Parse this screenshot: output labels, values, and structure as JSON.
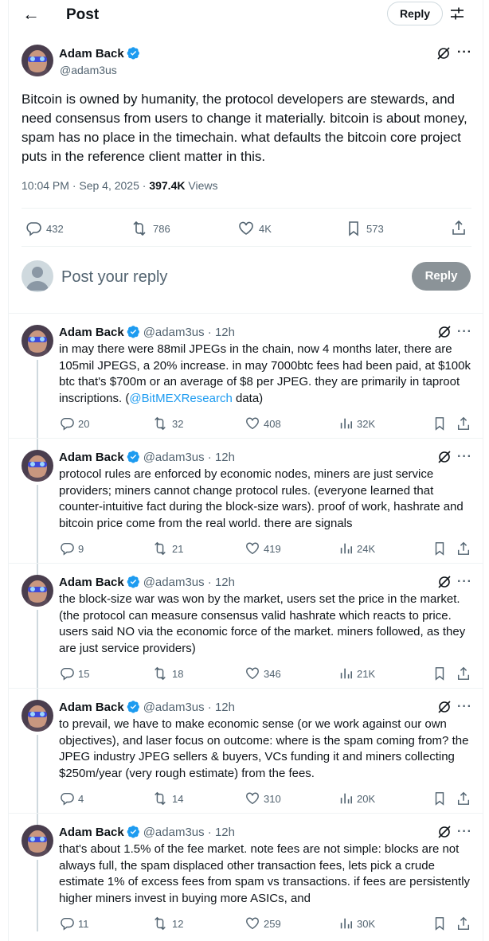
{
  "header": {
    "back_icon": "arrow-left-icon",
    "title": "Post",
    "reply_label": "Reply",
    "filter_icon": "sliders-icon"
  },
  "post": {
    "author": {
      "name": "Adam Back",
      "handle": "@adam3us",
      "verified": true
    },
    "text": "Bitcoin is owned by humanity, the protocol developers are stewards, and need consensus from users to change it materially. bitcoin is about money, spam has no place in the timechain. what defaults the bitcoin core project puts in the reference client matter in this.",
    "time": "10:04 PM · Sep 4, 2025 · ",
    "views_count": "397.4K",
    "views_label": " Views",
    "stats": {
      "replies": "432",
      "reposts": "786",
      "likes": "4K",
      "bookmarks": "573"
    }
  },
  "composer": {
    "placeholder": "Post your reply",
    "button": "Reply"
  },
  "accent": "#1d9bf0",
  "replies": [
    {
      "name": "Adam Back",
      "handle": "@adam3us · 12h",
      "text_before": "in may there were 88mil JPEGs in the chain, now 4 months later, there are 105mil JPEGS, a 20% increase. in may 7000btc fees had been paid, at $100k btc that's $700m or an average of $8 per JPEG. they are primarily in taproot inscriptions. (",
      "mention": "@BitMEXResearch",
      "text_after": " data)",
      "replies": "20",
      "reposts": "32",
      "likes": "408",
      "views": "32K"
    },
    {
      "name": "Adam Back",
      "handle": "@adam3us · 12h",
      "text_before": "protocol rules are enforced by economic nodes, miners are just service providers; miners cannot change protocol rules. (everyone learned that counter-intuitive fact during the block-size wars). proof of work, hashrate and bitcoin price come from the real world. there are signals",
      "mention": "",
      "text_after": "",
      "replies": "9",
      "reposts": "21",
      "likes": "419",
      "views": "24K"
    },
    {
      "name": "Adam Back",
      "handle": "@adam3us · 12h",
      "text_before": "the block-size war was won by the market, users set the price in the market. (the protocol can measure consensus valid hashrate which reacts to price. users said NO via the economic force of the market. miners followed, as they are just service providers)",
      "mention": "",
      "text_after": "",
      "replies": "15",
      "reposts": "18",
      "likes": "346",
      "views": "21K"
    },
    {
      "name": "Adam Back",
      "handle": "@adam3us · 12h",
      "text_before": "to prevail, we have to make economic sense (or we work against our own objectives), and laser focus on outcome: where is the spam coming from? the JPEG industry JPEG sellers & buyers, VCs funding it and miners collecting $250m/year (very rough estimate) from the fees.",
      "mention": "",
      "text_after": "",
      "replies": "4",
      "reposts": "14",
      "likes": "310",
      "views": "20K"
    },
    {
      "name": "Adam Back",
      "handle": "@adam3us · 12h",
      "text_before": "that's about 1.5% of the fee market. note fees are not simple: blocks are not always full, the spam displaced other transaction fees, lets pick a crude estimate 1% of excess fees from spam vs transactions. if fees are persistently higher miners invest in buying more ASICs, and",
      "mention": "",
      "text_after": "",
      "replies": "11",
      "reposts": "12",
      "likes": "259",
      "views": "30K"
    }
  ]
}
